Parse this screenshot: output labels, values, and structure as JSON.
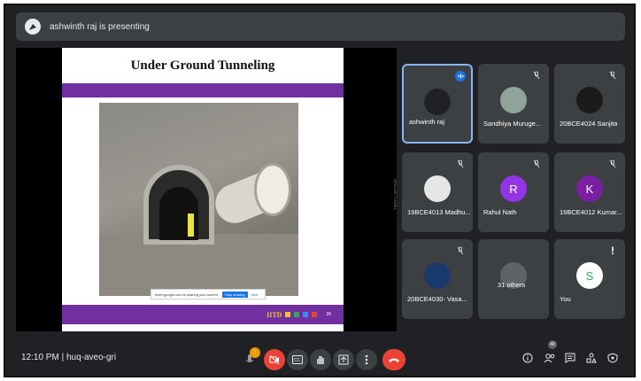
{
  "presenter_bar": {
    "text": "ashwinth raj is presenting"
  },
  "slide": {
    "title": "Under Ground Tunneling",
    "toast_text": "meet.google.com is sharing your screen.",
    "toast_stop": "Stop sharing",
    "toast_hide": "Hide",
    "logo_text": "IITD",
    "page_number": "26",
    "watermark": "GROUND TUNNEL"
  },
  "participants": [
    {
      "name": "ashwinth raj",
      "initial": "",
      "avatar_color": "#202124",
      "state": "speaking"
    },
    {
      "name": "Sandhiya Muruge...",
      "initial": "",
      "avatar_color": "#8fa39a",
      "state": "muted"
    },
    {
      "name": "20BCE4024 Sanjita",
      "initial": "",
      "avatar_color": "#1b1b1b",
      "state": "muted"
    },
    {
      "name": "19BCE4013 Madhu...",
      "initial": "",
      "avatar_color": "#e6e6e6",
      "state": "muted"
    },
    {
      "name": "Rahul Nath",
      "initial": "R",
      "avatar_color": "#9334e6",
      "state": "muted"
    },
    {
      "name": "19BCE4012 Kumar...",
      "initial": "K",
      "avatar_color": "#7b1fa2",
      "state": "muted"
    },
    {
      "name": "20BCE4030- Vasa...",
      "initial": "",
      "avatar_color": "#1a3a6b",
      "state": "muted"
    },
    {
      "name": "31 others",
      "initial": "",
      "avatar_color": "#5f6368",
      "state": "group"
    },
    {
      "name": "You",
      "initial": "S",
      "avatar_color": "#ffffff",
      "state": "alert"
    }
  ],
  "controls": {
    "time": "12:10 PM",
    "meeting_code": "huq-aveo-gri",
    "mic_badge": "!",
    "participant_count": "40"
  },
  "colors": {
    "background": "#202124",
    "tile": "#3c4043",
    "accent_red": "#ea4335",
    "slide_purple": "#7030a0"
  }
}
